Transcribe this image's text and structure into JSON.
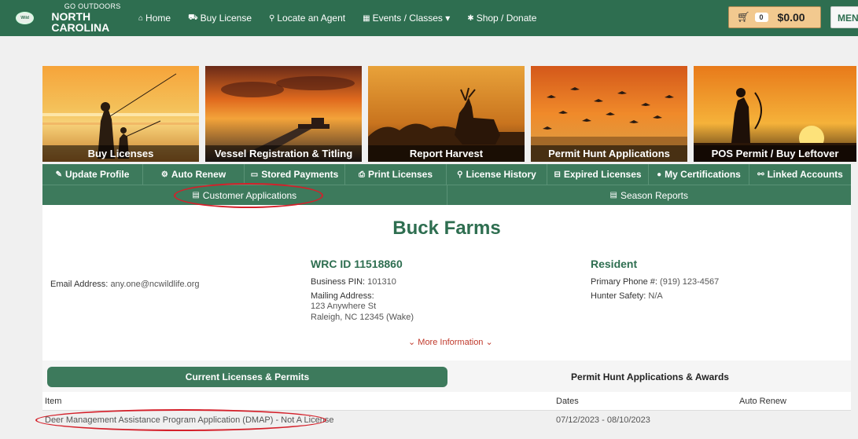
{
  "nav": {
    "logo_sub": "GO OUTDOORS",
    "logo_main": "NORTH CAROLINA",
    "logo_badge": "Wild",
    "links": [
      {
        "icon": "home-icon",
        "glyph": "⌂",
        "label": "Home"
      },
      {
        "icon": "cart-icon",
        "glyph": "⛟",
        "label": "Buy License"
      },
      {
        "icon": "map-marker-icon",
        "glyph": "⚲",
        "label": "Locate an Agent"
      },
      {
        "icon": "calendar-icon",
        "glyph": "▦",
        "label": "Events / Classes ▾"
      },
      {
        "icon": "gift-icon",
        "glyph": "✱",
        "label": "Shop / Donate"
      }
    ],
    "cart_count": "0",
    "cart_total": "$0.00",
    "menu_label": "MENU"
  },
  "tiles": [
    {
      "label": "Buy Licenses"
    },
    {
      "label": "Vessel Registration & Titling"
    },
    {
      "label": "Report Harvest"
    },
    {
      "label": "Permit Hunt Applications"
    },
    {
      "label": "POS Permit / Buy Leftover"
    }
  ],
  "menu1": [
    {
      "glyph": "✎",
      "label": "Update Profile",
      "icon": "edit-icon"
    },
    {
      "glyph": "⚙",
      "label": "Auto Renew",
      "icon": "gear-icon"
    },
    {
      "glyph": "▭",
      "label": "Stored Payments",
      "icon": "credit-card-icon"
    },
    {
      "glyph": "⎙",
      "label": "Print Licenses",
      "icon": "print-icon"
    },
    {
      "glyph": "⚲",
      "label": "License History",
      "icon": "search-icon"
    },
    {
      "glyph": "⊟",
      "label": "Expired Licenses",
      "icon": "minus-square-icon"
    },
    {
      "glyph": "●",
      "label": "My Certifications",
      "icon": "certificate-icon"
    },
    {
      "glyph": "⚯",
      "label": "Linked Accounts",
      "icon": "link-icon"
    }
  ],
  "menu2": [
    {
      "glyph": "▤",
      "label": "Customer Applications",
      "icon": "document-icon"
    },
    {
      "glyph": "▤",
      "label": "Season Reports",
      "icon": "file-icon"
    }
  ],
  "profile": {
    "name": "Buck Farms",
    "email_label": "Email Address:",
    "email": "any.one@ncwildlife.org",
    "wrc_id": "WRC ID 11518860",
    "pin_label": "Business PIN:",
    "pin": "101310",
    "mailing_label": "Mailing Address:",
    "address1": "123 Anywhere St",
    "address2": "Raleigh, NC 12345 (Wake)",
    "residency": "Resident",
    "phone_label": "Primary Phone #:",
    "phone": "(919) 123-4567",
    "hunter_label": "Hunter Safety:",
    "hunter": "N/A",
    "more_info": "More Information"
  },
  "tabs": {
    "active": "Current Licenses & Permits",
    "inactive": "Permit Hunt Applications & Awards"
  },
  "table": {
    "headers": [
      "Item",
      "Dates",
      "Auto Renew"
    ],
    "rows": [
      {
        "item": "Deer Management Assistance Program Application (DMAP) - Not A License",
        "dates": "07/12/2023 - 08/10/2023",
        "auto_renew": ""
      }
    ]
  },
  "colors": {
    "brand_green": "#2e6e50",
    "menu_green": "#3d7a5c",
    "annotation_red": "#d4202a",
    "more_info_red": "#c0392b",
    "cart_orange": "#f2c98f"
  }
}
